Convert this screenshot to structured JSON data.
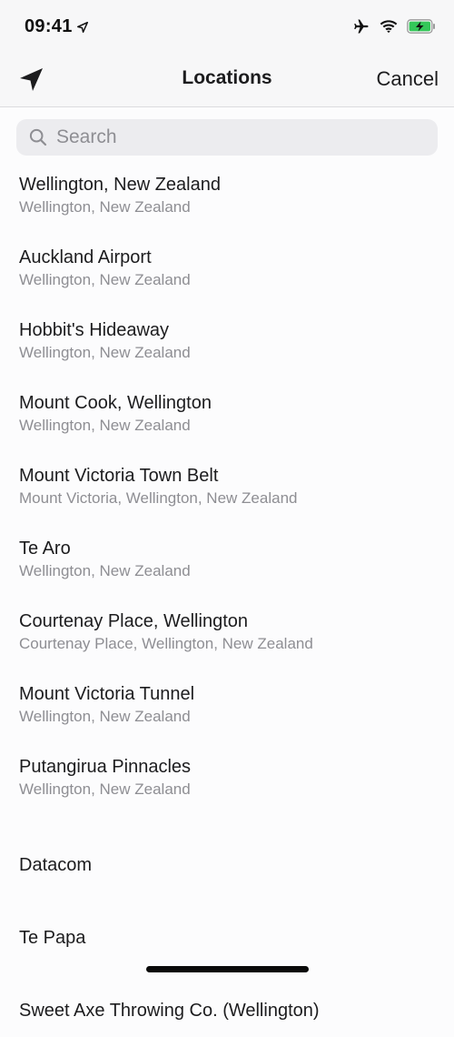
{
  "status_bar": {
    "time": "09:41",
    "icons": [
      "location-arrow-icon",
      "airplane-icon",
      "wifi-icon",
      "battery-charging-icon"
    ],
    "battery_color": "#34c759"
  },
  "navbar": {
    "left_icon": "location-arrow-icon",
    "title": "Locations",
    "cancel_label": "Cancel"
  },
  "search": {
    "placeholder": "Search",
    "value": ""
  },
  "locations": [
    {
      "title": "Wellington, New Zealand",
      "subtitle": "Wellington, New Zealand"
    },
    {
      "title": "Auckland Airport",
      "subtitle": "Wellington, New Zealand"
    },
    {
      "title": "Hobbit's Hideaway",
      "subtitle": "Wellington, New Zealand"
    },
    {
      "title": "Mount Cook, Wellington",
      "subtitle": "Wellington, New Zealand"
    },
    {
      "title": "Mount Victoria Town Belt",
      "subtitle": "Mount Victoria, Wellington, New Zealand"
    },
    {
      "title": "Te Aro",
      "subtitle": "Wellington, New Zealand"
    },
    {
      "title": "Courtenay Place, Wellington",
      "subtitle": "Courtenay Place, Wellington, New Zealand"
    },
    {
      "title": "Mount Victoria Tunnel",
      "subtitle": "Wellington, New Zealand"
    },
    {
      "title": "Putangirua Pinnacles",
      "subtitle": "Wellington, New Zealand"
    },
    {
      "title": "Datacom",
      "subtitle": ""
    },
    {
      "title": "Te Papa",
      "subtitle": ""
    },
    {
      "title": "Sweet Axe Throwing Co. (Wellington)",
      "subtitle": ""
    }
  ]
}
